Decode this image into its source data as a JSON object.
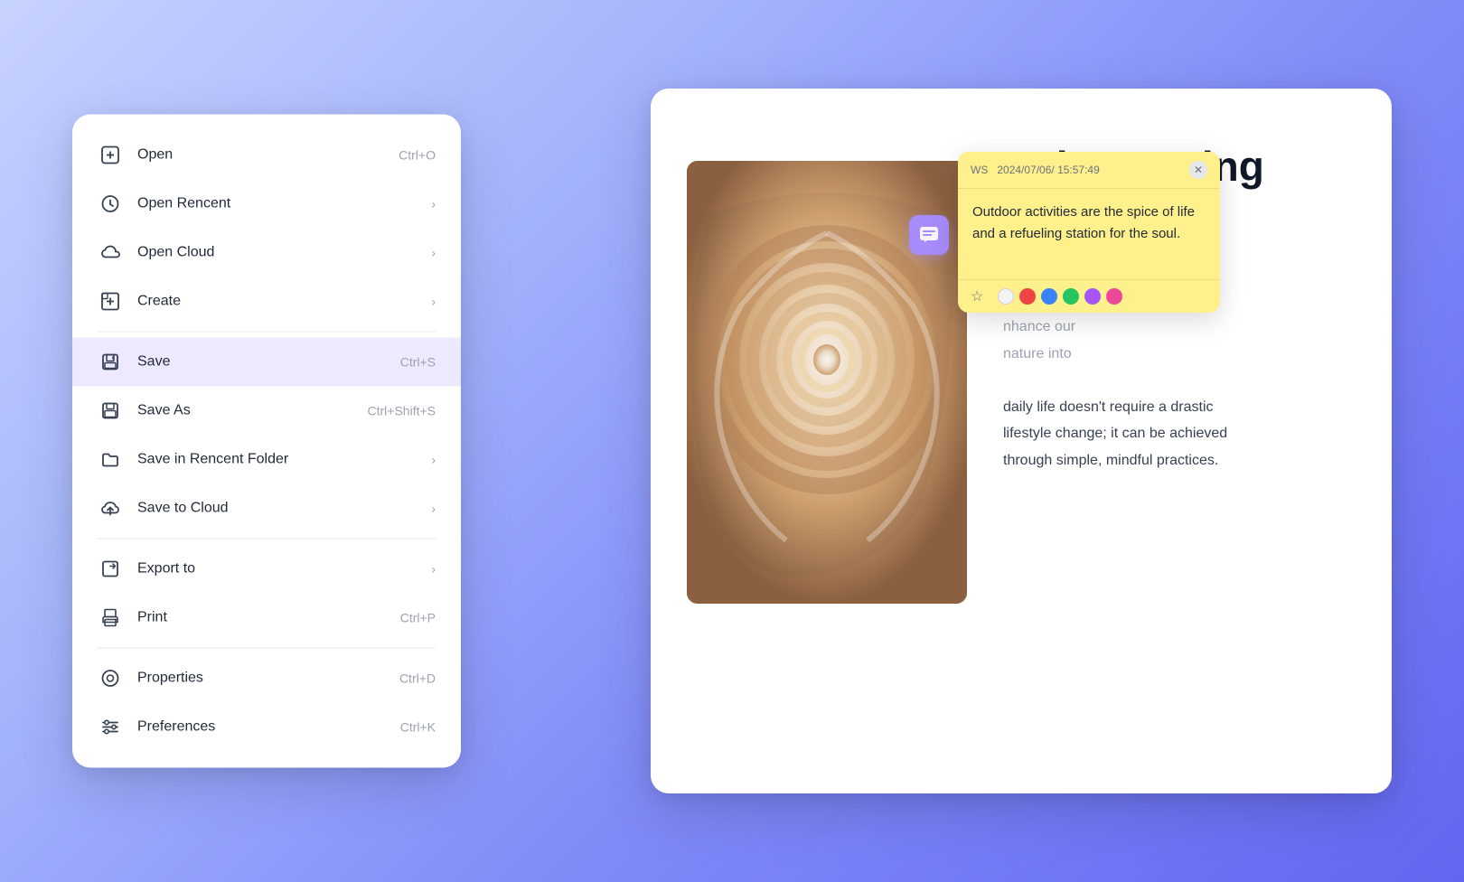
{
  "menu": {
    "items": [
      {
        "id": "open",
        "label": "Open",
        "shortcut": "Ctrl+O",
        "icon": "open-icon",
        "has_arrow": false
      },
      {
        "id": "open-recent",
        "label": "Open Rencent",
        "shortcut": "",
        "icon": "clock-icon",
        "has_arrow": true
      },
      {
        "id": "open-cloud",
        "label": "Open Cloud",
        "shortcut": "",
        "icon": "cloud-download-icon",
        "has_arrow": true
      },
      {
        "id": "create",
        "label": "Create",
        "shortcut": "",
        "icon": "create-icon",
        "has_arrow": true
      },
      {
        "id": "save",
        "label": "Save",
        "shortcut": "Ctrl+S",
        "icon": "save-icon",
        "has_arrow": false,
        "active": true
      },
      {
        "id": "save-as",
        "label": "Save As",
        "shortcut": "Ctrl+Shift+S",
        "icon": "save-as-icon",
        "has_arrow": false
      },
      {
        "id": "save-recent-folder",
        "label": "Save in Rencent Folder",
        "shortcut": "",
        "icon": "folder-icon",
        "has_arrow": true
      },
      {
        "id": "save-cloud",
        "label": "Save to Cloud",
        "shortcut": "",
        "icon": "cloud-upload-icon",
        "has_arrow": true
      },
      {
        "id": "export",
        "label": "Export to",
        "shortcut": "",
        "icon": "export-icon",
        "has_arrow": true
      },
      {
        "id": "print",
        "label": "Print",
        "shortcut": "Ctrl+P",
        "icon": "print-icon",
        "has_arrow": false
      },
      {
        "id": "properties",
        "label": "Properties",
        "shortcut": "Ctrl+D",
        "icon": "properties-icon",
        "has_arrow": false
      },
      {
        "id": "preferences",
        "label": "Preferences",
        "shortcut": "Ctrl+K",
        "icon": "preferences-icon",
        "has_arrow": false
      }
    ],
    "divider_after": [
      "create",
      "save-cloud",
      "print",
      "properties"
    ]
  },
  "document": {
    "title": "Rejuvenating\nActivities",
    "body_text": "world,\nwith\nnhance our\nnature into\ndaily life doesn't require a drastic\nlifestyle change; it can be achieved\nthrough simple, mindful practices.",
    "image_alt": "Spiral staircase viewed from above"
  },
  "sticky_note": {
    "meta_prefix": "WS",
    "timestamp": "2024/07/06/ 15:57:49",
    "text": "Outdoor activities are the spice of life and a refueling station for the soul.",
    "colors": [
      "#f3f4f6",
      "#ef4444",
      "#3b82f6",
      "#22c55e",
      "#a855f7",
      "#ec4899"
    ]
  }
}
